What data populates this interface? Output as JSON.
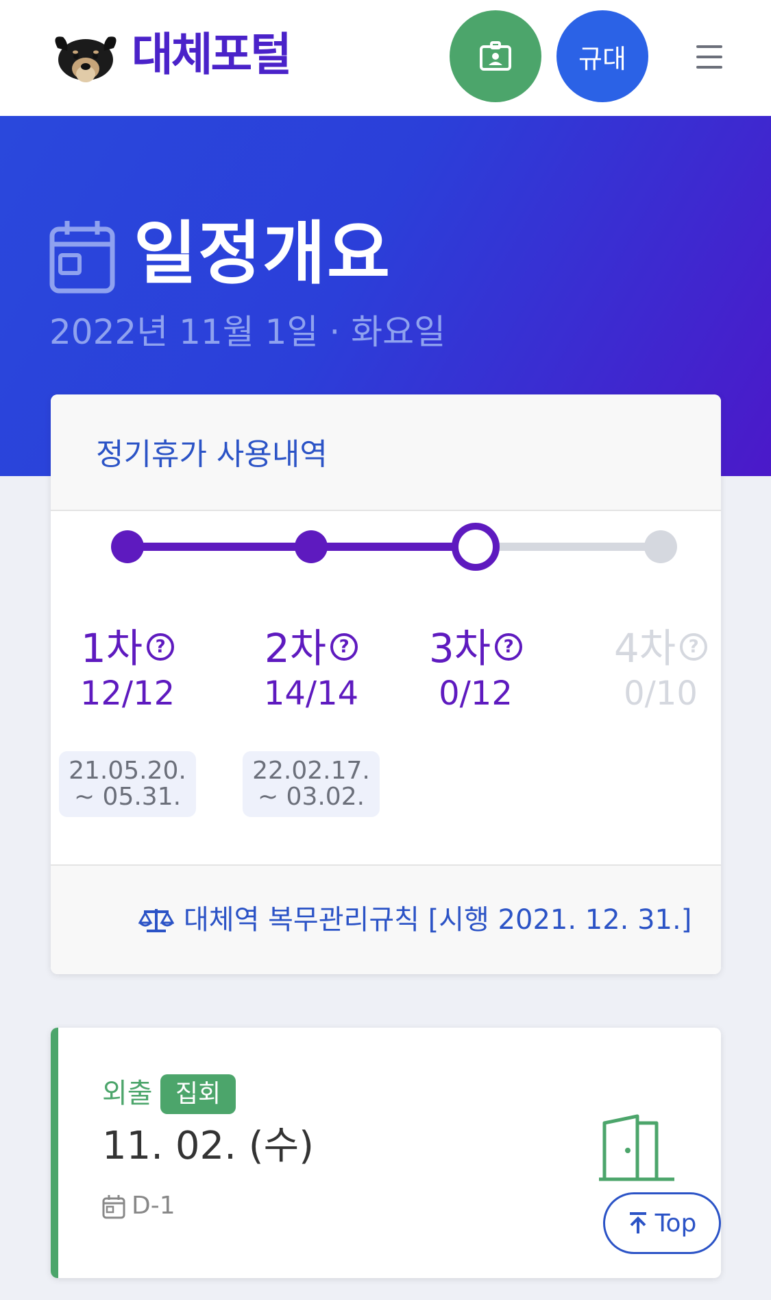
{
  "header": {
    "logo_text": "대체포털",
    "user_button_label": "규대"
  },
  "hero": {
    "title": "일정개요",
    "date": "2022년 11월 1일 · 화요일"
  },
  "vacation_card": {
    "title": "정기휴가 사용내역",
    "steps": [
      {
        "label": "1차",
        "help": "?",
        "count": "12/12",
        "date_range": [
          "21.05.20.",
          "~ 05.31."
        ],
        "state": "done"
      },
      {
        "label": "2차",
        "help": "?",
        "count": "14/14",
        "date_range": [
          "22.02.17.",
          "~ 03.02."
        ],
        "state": "done"
      },
      {
        "label": "3차",
        "help": "?",
        "count": "0/12",
        "date_range": [],
        "state": "current"
      },
      {
        "label": "4차",
        "help": "?",
        "count": "0/10",
        "date_range": [],
        "state": "upcoming"
      }
    ],
    "footer_link": "대체역 복무관리규칙 [시행 2021. 12. 31.]"
  },
  "outing_card": {
    "type": "외출",
    "badge": "집회",
    "date": "11. 02. (수)",
    "dday": "D-1"
  },
  "top_button_label": "Top",
  "colors": {
    "accent_purple": "#5e1abf",
    "brand_blue": "#2b53c6",
    "green": "#4ca56b",
    "user_blue": "#2b62e6"
  }
}
